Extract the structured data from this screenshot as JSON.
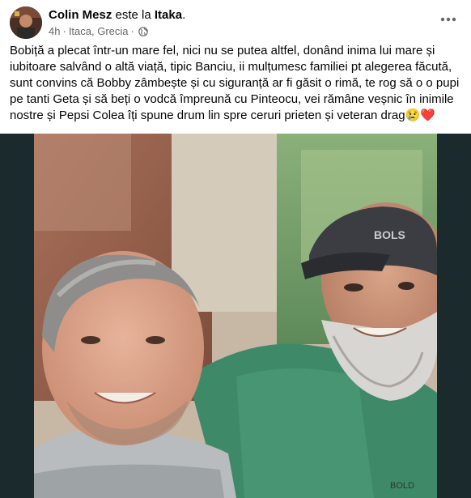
{
  "post": {
    "author": "Colin Mesz",
    "verb": "este la",
    "place": "Itaka",
    "place_suffix": ".",
    "time": "4h",
    "separator": "·",
    "location": "Itaca, Grecia",
    "separator2": "·",
    "privacy_icon": "globe-icon",
    "more_icon": "more-options-icon",
    "text_lines": [
      "Bobiță a plecat într-un mare fel, nici nu se putea altfel, donând inima lui mare și",
      "iubitoare salvând o altă viață, tipic Banciu, ii mulțumesc familiei pt alegerea făcută,",
      "sunt convins că Bobby zâmbește și cu siguranță ar fi găsit o rimă, te rog să o o pupi",
      "pe tanti Geta și să beți o vodcă împreună cu Pinteocu, vei rămâne veșnic în inimile",
      "nostre și Pepsi Colea îți spune drum lin spre ceruri prieten și veteran drag"
    ],
    "emojis": [
      "😢",
      "❤️"
    ],
    "photo_cap_text": "BOLS",
    "photo_shirt_text": "BOLD"
  },
  "colors": {
    "text": "#050505",
    "secondary": "#65676b",
    "photo_frame": "#1b2b2d",
    "heart": "#e41e3f"
  }
}
